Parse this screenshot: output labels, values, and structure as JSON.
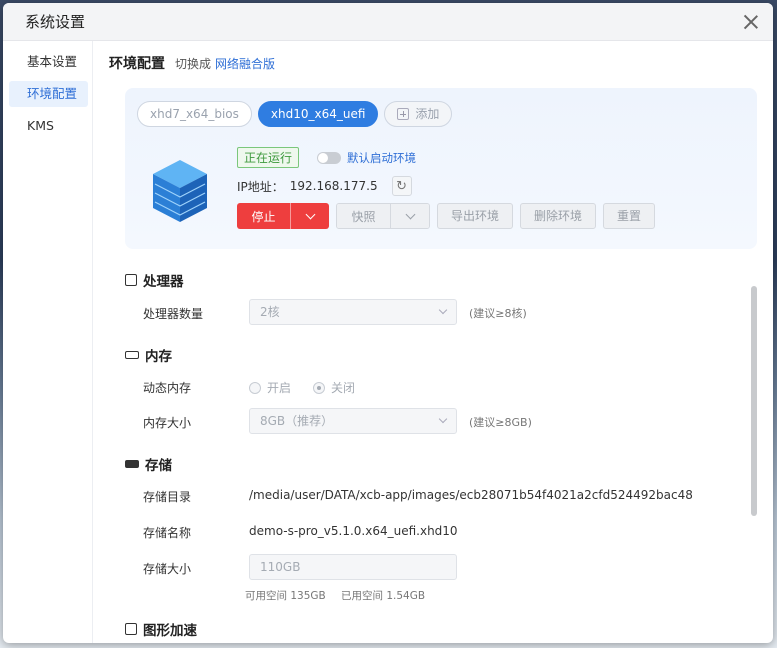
{
  "window": {
    "title": "系统设置"
  },
  "sidebar": {
    "items": [
      {
        "label": "基本设置",
        "active": false
      },
      {
        "label": "环境配置",
        "active": true
      },
      {
        "label": "KMS",
        "active": false
      }
    ]
  },
  "header": {
    "title": "环境配置",
    "switch_text": "切换成",
    "switch_link": "网络融合版"
  },
  "env": {
    "tabs": [
      "xhd7_x64_bios",
      "xhd10_x64_uefi"
    ],
    "add_label": "添加",
    "status_badge": "正在运行",
    "default_env_label": "默认启动环境",
    "ip_label": "IP地址：",
    "ip_value": "192.168.177.5",
    "buttons": {
      "stop": "停止",
      "snapshot": "快照",
      "export": "导出环境",
      "delete": "删除环境",
      "reset": "重置"
    }
  },
  "cpu": {
    "title": "处理器",
    "count_label": "处理器数量",
    "count_value": "2核",
    "hint": "(建议≥8核)"
  },
  "memory": {
    "title": "内存",
    "dynamic_label": "动态内存",
    "option_on": "开启",
    "option_off": "关闭",
    "size_label": "内存大小",
    "size_value": "8GB（推荐）",
    "hint": "(建议≥8GB)"
  },
  "storage": {
    "title": "存储",
    "dir_label": "存储目录",
    "dir_value": "/media/user/DATA/xcb-app/images/ecb28071b54f4021a2cfd524492bac48",
    "name_label": "存储名称",
    "name_value": "demo-s-pro_v5.1.0.x64_uefi.xhd10",
    "size_label": "存储大小",
    "size_value": "110GB",
    "available": "可用空间 135GB",
    "used": "已用空间 1.54GB"
  },
  "graphics": {
    "title": "图形加速"
  }
}
